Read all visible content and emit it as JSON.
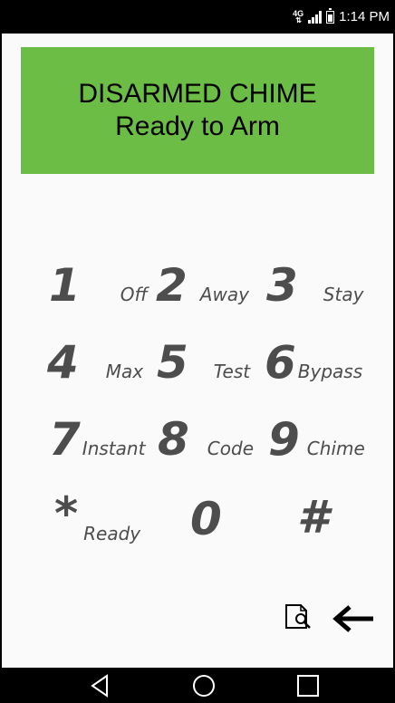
{
  "status_bar": {
    "network_type": "4G",
    "time": "1:14 PM",
    "icons": [
      "data-arrows-icon",
      "signal-icon",
      "battery-icon"
    ]
  },
  "banner": {
    "line1": "DISARMED CHIME",
    "line2": "Ready to Arm",
    "color": "#6cbd45"
  },
  "keypad": {
    "keys": [
      {
        "digit": "1",
        "label": "Off"
      },
      {
        "digit": "2",
        "label": "Away"
      },
      {
        "digit": "3",
        "label": "Stay"
      },
      {
        "digit": "4",
        "label": "Max"
      },
      {
        "digit": "5",
        "label": "Test"
      },
      {
        "digit": "6",
        "label": "Bypass"
      },
      {
        "digit": "7",
        "label": "Instant"
      },
      {
        "digit": "8",
        "label": "Code"
      },
      {
        "digit": "9",
        "label": "Chime"
      },
      {
        "digit": "*",
        "label": "Ready"
      },
      {
        "digit": "0",
        "label": ""
      },
      {
        "digit": "#",
        "label": ""
      }
    ]
  },
  "actions": {
    "icons": [
      "history-icon",
      "back-arrow-icon"
    ]
  },
  "nav_bar": {
    "icons": [
      "nav-back-icon",
      "nav-home-icon",
      "nav-recents-icon"
    ]
  }
}
